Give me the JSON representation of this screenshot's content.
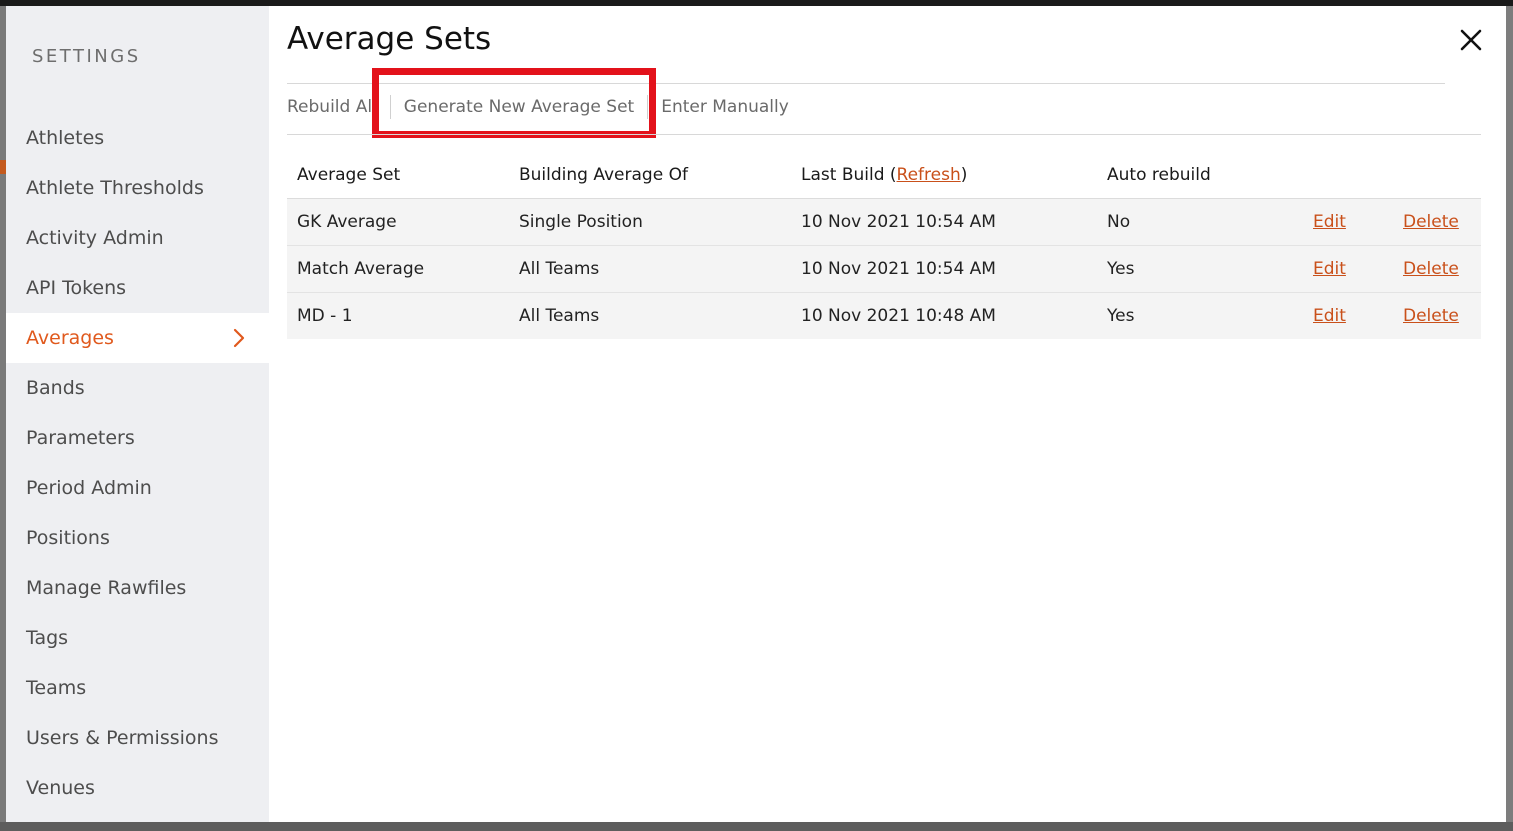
{
  "sidebar": {
    "heading": "SETTINGS",
    "items": [
      {
        "label": "Athletes",
        "active": false
      },
      {
        "label": "Athlete Thresholds",
        "active": false
      },
      {
        "label": "Activity Admin",
        "active": false
      },
      {
        "label": "API Tokens",
        "active": false
      },
      {
        "label": "Averages",
        "active": true
      },
      {
        "label": "Bands",
        "active": false
      },
      {
        "label": "Parameters",
        "active": false
      },
      {
        "label": "Period Admin",
        "active": false
      },
      {
        "label": "Positions",
        "active": false
      },
      {
        "label": "Manage Rawfiles",
        "active": false
      },
      {
        "label": "Tags",
        "active": false
      },
      {
        "label": "Teams",
        "active": false
      },
      {
        "label": "Users & Permissions",
        "active": false
      },
      {
        "label": "Venues",
        "active": false
      }
    ],
    "active_icon": "chevron-right-icon"
  },
  "main": {
    "title": "Average Sets",
    "close_icon": "close-icon",
    "toolbar": {
      "rebuild_all": "Rebuild All",
      "generate_new": "Generate New Average Set",
      "enter_manually": "Enter Manually"
    },
    "table": {
      "headers": {
        "average_set": "Average Set",
        "building_average_of": "Building Average Of",
        "last_build_prefix": "Last Build (",
        "last_build_refresh": "Refresh",
        "last_build_suffix": ")",
        "auto_rebuild": "Auto rebuild"
      },
      "rows": [
        {
          "name": "GK Average",
          "building": "Single Position",
          "last_build": "10 Nov 2021 10:54 AM",
          "auto_rebuild": "No",
          "edit": "Edit",
          "delete": "Delete"
        },
        {
          "name": "Match Average",
          "building": "All Teams",
          "last_build": "10 Nov 2021 10:54 AM",
          "auto_rebuild": "Yes",
          "edit": "Edit",
          "delete": "Delete"
        },
        {
          "name": "MD - 1",
          "building": "All Teams",
          "last_build": "10 Nov 2021 10:48 AM",
          "auto_rebuild": "Yes",
          "edit": "Edit",
          "delete": "Delete"
        }
      ]
    }
  },
  "colors": {
    "accent": "#e0591d",
    "link": "#c9501a",
    "highlight": "#e3121b",
    "sidebar_bg": "#eeeff2"
  }
}
